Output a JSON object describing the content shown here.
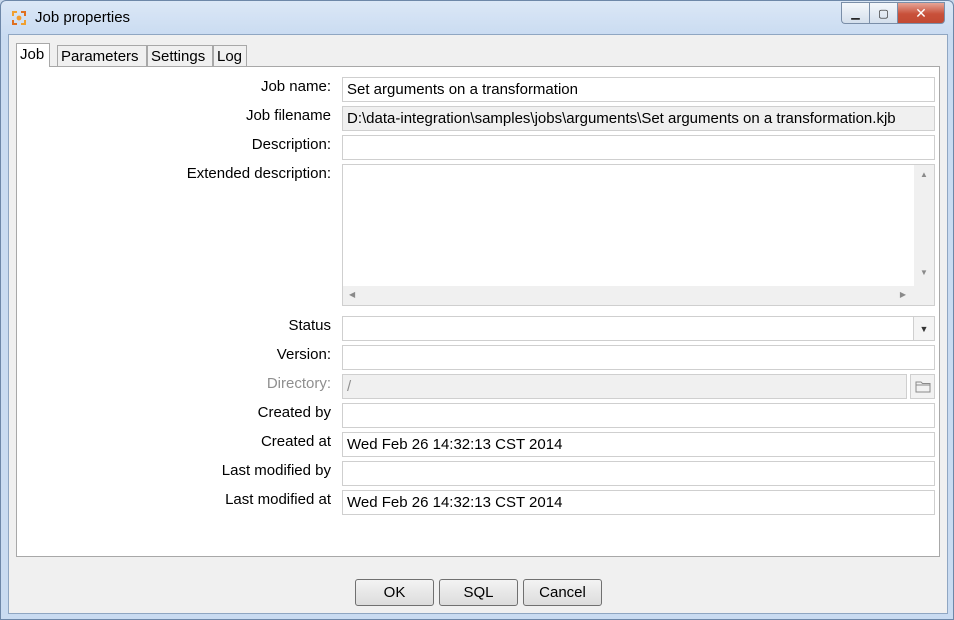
{
  "window": {
    "title": "Job properties"
  },
  "tabs": [
    {
      "label": "Job"
    },
    {
      "label": "Parameters"
    },
    {
      "label": "Settings"
    },
    {
      "label": "Log"
    }
  ],
  "form": {
    "job_name": {
      "label": "Job name:",
      "value": "Set arguments on a transformation"
    },
    "job_filename": {
      "label": "Job filename",
      "value": "D:\\data-integration\\samples\\jobs\\arguments\\Set arguments on a transformation.kjb"
    },
    "description": {
      "label": "Description:",
      "value": ""
    },
    "extended_description": {
      "label": "Extended description:",
      "value": ""
    },
    "status": {
      "label": "Status",
      "value": ""
    },
    "version": {
      "label": "Version:",
      "value": ""
    },
    "directory": {
      "label": "Directory:",
      "value": "/"
    },
    "created_by": {
      "label": "Created by",
      "value": ""
    },
    "created_at": {
      "label": "Created at",
      "value": "Wed Feb 26 14:32:13 CST 2014"
    },
    "last_modified_by": {
      "label": "Last modified by",
      "value": ""
    },
    "last_modified_at": {
      "label": "Last modified at",
      "value": "Wed Feb 26 14:32:13 CST 2014"
    }
  },
  "buttons": {
    "ok": "OK",
    "sql": "SQL",
    "cancel": "Cancel"
  },
  "window_controls": {
    "minimize": "▁",
    "maximize": "▢",
    "close": "✕"
  },
  "icons": {
    "app": "kettle-spoon-icon",
    "folder": "folder-icon",
    "combo": "chevron-down-icon"
  },
  "colors": {
    "titlebar": "#c9dbf1",
    "close_button": "#c8503a"
  }
}
